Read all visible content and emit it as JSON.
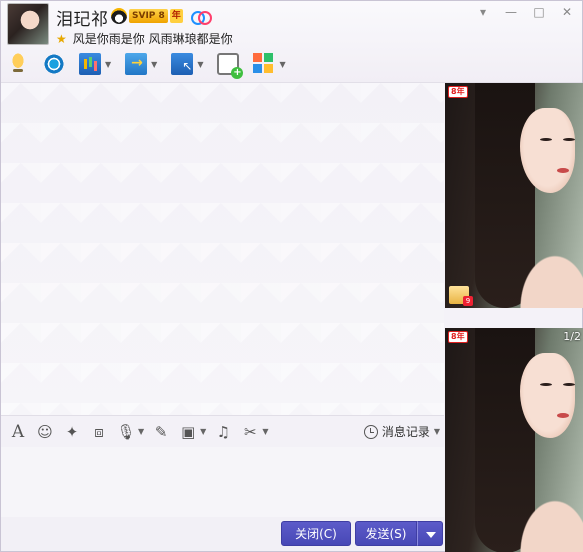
{
  "header": {
    "name": "泪玘祁",
    "svip_label": "SVIP 8",
    "year_label": "年",
    "signature": "风是你雨是你 风雨琳琅都是你"
  },
  "window_controls": {
    "dropdown": "▾",
    "minimize": "—",
    "maximize": "□",
    "close": "✕"
  },
  "input_toolbar": {
    "history_label": "消息记录"
  },
  "buttons": {
    "close_label": "关闭(C)",
    "send_label": "发送(S)"
  },
  "right_panel": {
    "vip_badge": "8年",
    "page_counter": "1/2"
  }
}
